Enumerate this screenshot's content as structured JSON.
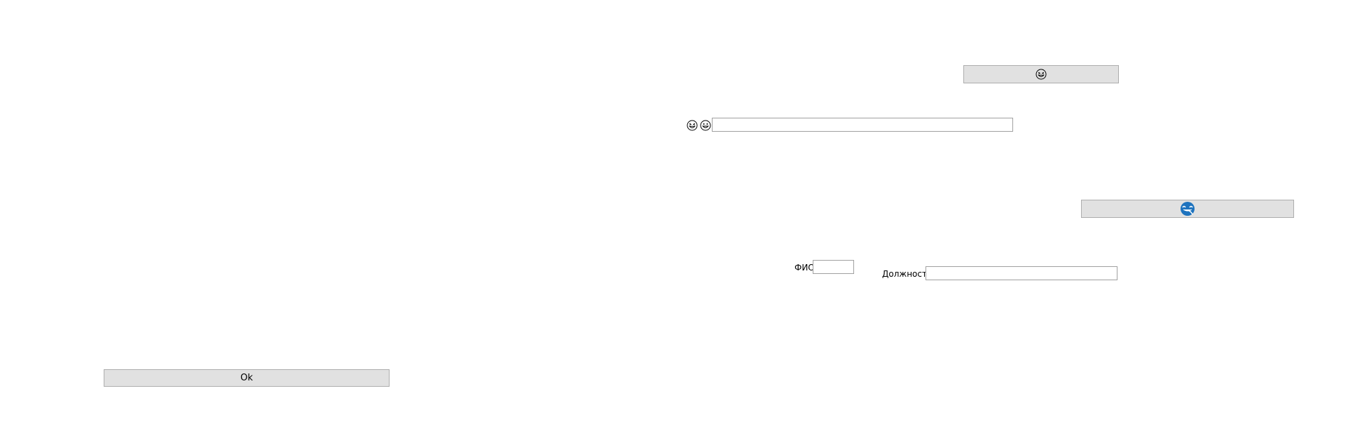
{
  "ok_button": {
    "label": "Ok"
  },
  "top_emoji_button": {
    "icon": "grinning-squint-face-icon"
  },
  "emoji_row": {
    "icon1": "grinning-squint-face-icon",
    "icon2": "grinning-face-icon",
    "input_value": ""
  },
  "blue_emoji_button": {
    "icon": "blue-face-with-tongue-icon",
    "icon_color": "#1e73be"
  },
  "fio": {
    "label": "ФИО",
    "value": ""
  },
  "position": {
    "label": "Должность",
    "value": ""
  }
}
